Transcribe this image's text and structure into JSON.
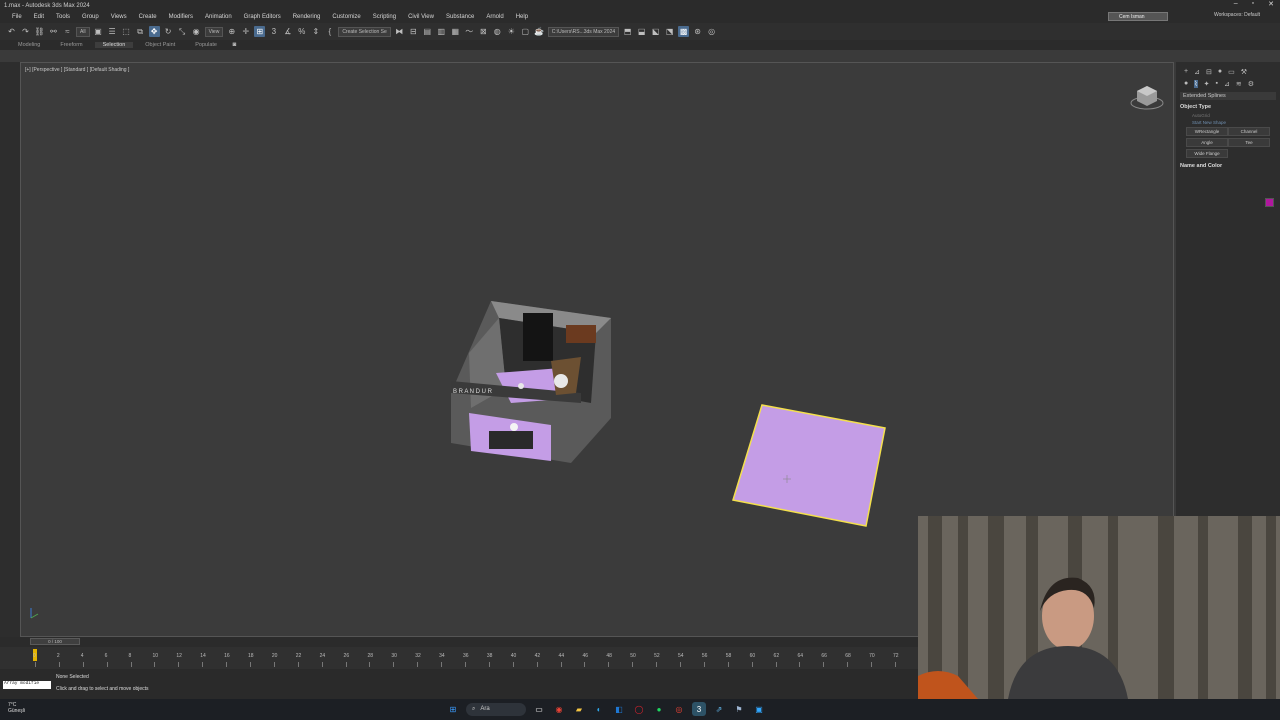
{
  "window": {
    "title": "1.max - Autodesk 3ds Max 2024"
  },
  "menu": [
    "File",
    "Edit",
    "Tools",
    "Group",
    "Views",
    "Create",
    "Modifiers",
    "Animation",
    "Graph Editors",
    "Rendering",
    "Customize",
    "Scripting",
    "Civil View",
    "Substance",
    "Arnold",
    "Help"
  ],
  "account": {
    "user": "Cem Isman",
    "workspaces_label": "Workspaces:",
    "workspace": "Default"
  },
  "toolbar": {
    "filter": "All",
    "view": "View",
    "selection_set": "Create Selection Se",
    "path": "C:\\Users\\RS...3ds Max 2024"
  },
  "ribbon": {
    "tabs": [
      "Modeling",
      "Freeform",
      "Selection",
      "Object Paint",
      "Populate"
    ],
    "selected": "Selection"
  },
  "viewport": {
    "label": "[+] [Perspective ] [Standard ] [Default Shading ]"
  },
  "command_panel": {
    "category": "Extended Splines",
    "object_type_title": "Object Type",
    "autogrid": "AutoGrid",
    "start_new_shape": "Start New Shape",
    "buttons": [
      [
        "WRectangle",
        "Channel"
      ],
      [
        "Angle",
        "Tee"
      ],
      [
        "Wide Flange",
        ""
      ]
    ],
    "name_color_title": "Name and Color"
  },
  "timeslider": {
    "label": "0 / 100"
  },
  "trackbar": {
    "ticks": [
      "0",
      "2",
      "4",
      "6",
      "8",
      "10",
      "12",
      "14",
      "16",
      "18",
      "20",
      "22",
      "24",
      "26",
      "28",
      "30",
      "32",
      "34",
      "36",
      "38",
      "40",
      "42",
      "44",
      "46",
      "48",
      "50",
      "52",
      "54",
      "56",
      "58",
      "60",
      "62",
      "64",
      "66",
      "68",
      "70",
      "72"
    ]
  },
  "status": {
    "maxscript": "Array modifie",
    "selected": "None Selected",
    "prompt": "Click and drag to select and move objects"
  },
  "taskbar": {
    "temperature": "7°C",
    "weather": "Güneşli",
    "search": "Ara"
  },
  "colors": {
    "accent": "#4a6b8f",
    "plane": "#c49de6",
    "selection": "#f4e04d",
    "swatch": "#b0179e"
  }
}
